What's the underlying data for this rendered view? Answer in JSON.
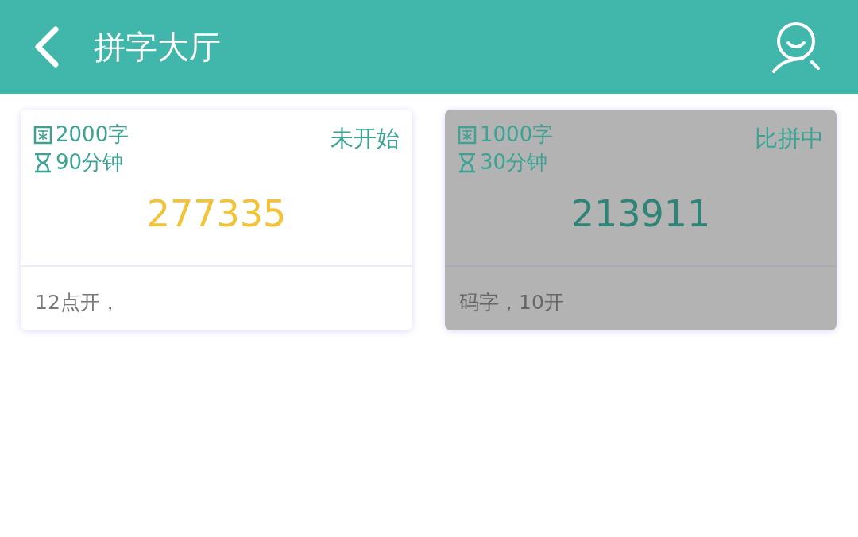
{
  "header": {
    "title": "拼字大厅"
  },
  "rooms": [
    {
      "kind": "waiting",
      "words": "2000字",
      "duration": "90分钟",
      "status": "未开始",
      "room_number": "277335",
      "note": "12点开，"
    },
    {
      "kind": "running",
      "words": "1000字",
      "duration": "30分钟",
      "status": "比拼中",
      "room_number": "213911",
      "note": "码字，10开"
    }
  ]
}
